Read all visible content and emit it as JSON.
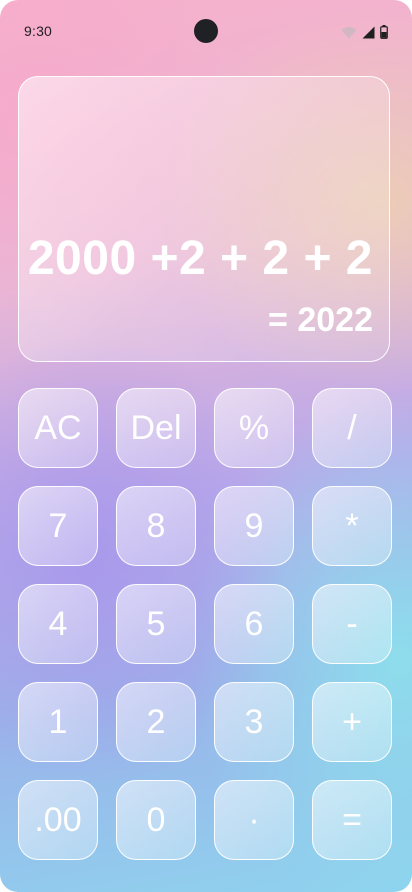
{
  "status_bar": {
    "time": "9:30",
    "icons": [
      "wifi-icon",
      "cellular-signal-icon",
      "battery-icon"
    ]
  },
  "display": {
    "expression": "2000 +2 + 2 + 2",
    "result": "= 2022"
  },
  "keypad": {
    "rows": [
      [
        "AC",
        "Del",
        "%",
        "/"
      ],
      [
        "7",
        "8",
        "9",
        "*"
      ],
      [
        "4",
        "5",
        "6",
        "-"
      ],
      [
        "1",
        "2",
        "3",
        "+"
      ],
      [
        ".00",
        "0",
        "·",
        "="
      ]
    ]
  },
  "colors": {
    "key_text": "#ffffff",
    "key_border": "#ffffff",
    "status_text": "#1f1f1f",
    "background_top": "#f6b1cb",
    "background_middle": "#b7a8ea",
    "background_bottom": "#8fd3ee"
  }
}
